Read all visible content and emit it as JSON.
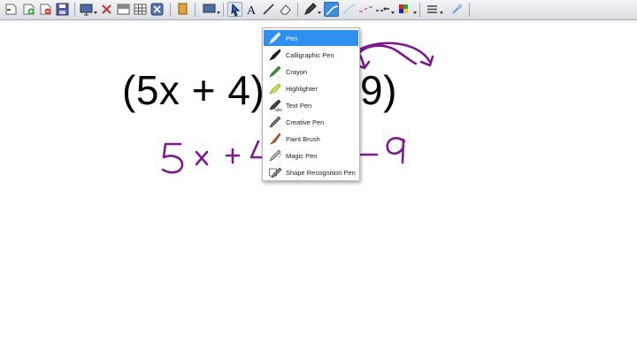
{
  "whiteboard": {
    "equation": "(5x + 4)(2x - 9)"
  },
  "pen_menu": {
    "items": [
      {
        "label": "Pen",
        "icon": "pen-icon",
        "selected": true
      },
      {
        "label": "Calligraphic Pen",
        "icon": "calligraphic-pen-icon",
        "selected": false
      },
      {
        "label": "Crayon",
        "icon": "crayon-icon",
        "selected": false
      },
      {
        "label": "Highlighter",
        "icon": "highlighter-icon",
        "selected": false
      },
      {
        "label": "Text Pen",
        "icon": "text-pen-icon",
        "selected": false
      },
      {
        "label": "Creative Pen",
        "icon": "creative-pen-icon",
        "selected": false
      },
      {
        "label": "Paint Brush",
        "icon": "paint-brush-icon",
        "selected": false
      },
      {
        "label": "Magic Pen",
        "icon": "magic-pen-icon",
        "selected": false
      },
      {
        "label": "Shape Recognition Pen",
        "icon": "shape-recognition-pen-icon",
        "selected": false
      }
    ]
  },
  "colors": {
    "ink": "#7a1a8c",
    "selection": "#2f8ff0",
    "toolbar_active": "#3c8fe0"
  }
}
